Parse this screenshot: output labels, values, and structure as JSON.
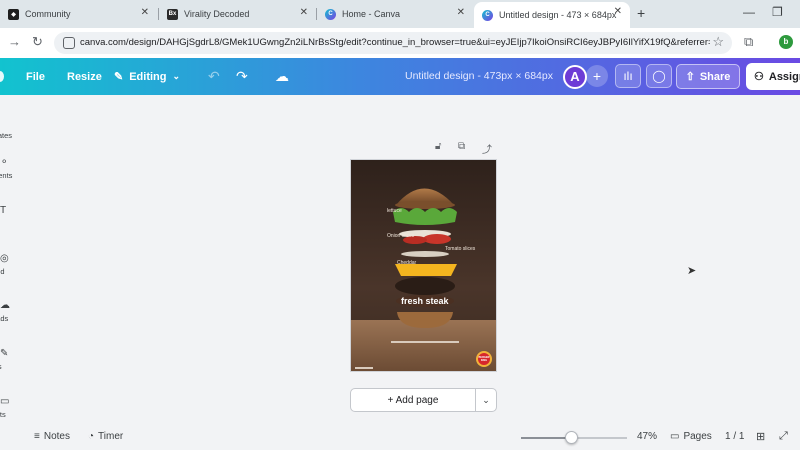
{
  "browser": {
    "tabs": [
      {
        "title": "Community",
        "icon": "canva-community-icon"
      },
      {
        "title": "Virality Decoded",
        "icon": "virality-decoded-icon"
      },
      {
        "title": "Home - Canva",
        "icon": "canva-icon"
      },
      {
        "title": "Untitled design - 473 × 684px",
        "icon": "canva-icon"
      }
    ],
    "address": "canva.com/design/DAHGjSgdrL8/GMek1UGwngZn2iLNrBsStg/edit?continue_in_browser=true&ui=eyJEIjp7IkoiOnsiRCI6eyJBPyI6IlYifX19fQ&referrer=ht...",
    "profile_initial": "b"
  },
  "header": {
    "file_label": "File",
    "resize_label": "Resize",
    "mode_label": "Editing",
    "design_title": "Untitled design - 473px × 684px",
    "avatar_initial": "A",
    "share_label": "Share",
    "assign_label": "Assign"
  },
  "sidebar": {
    "items": [
      {
        "label": "plates",
        "icon": "templates-icon"
      },
      {
        "label": "ments",
        "icon": "elements-icon"
      },
      {
        "label": "xt",
        "icon": "text-icon"
      },
      {
        "label": "and",
        "icon": "brand-icon"
      },
      {
        "label": "oads",
        "icon": "uploads-icon"
      },
      {
        "label": "ols",
        "icon": "tools-icon"
      },
      {
        "label": "ects",
        "icon": "projects-icon"
      }
    ]
  },
  "canvas": {
    "add_page_label": "+ Add page",
    "poster": {
      "labels": [
        "lettuce",
        "Onion slices",
        "Tomato slices",
        "Cheddar",
        "fresh steak"
      ],
      "brand": "BURGER KING"
    }
  },
  "footer": {
    "notes_label": "Notes",
    "timer_label": "Timer",
    "zoom_label": "47%",
    "zoom_level": 0.47,
    "pages_label": "Pages",
    "page_count": "1 / 1"
  }
}
